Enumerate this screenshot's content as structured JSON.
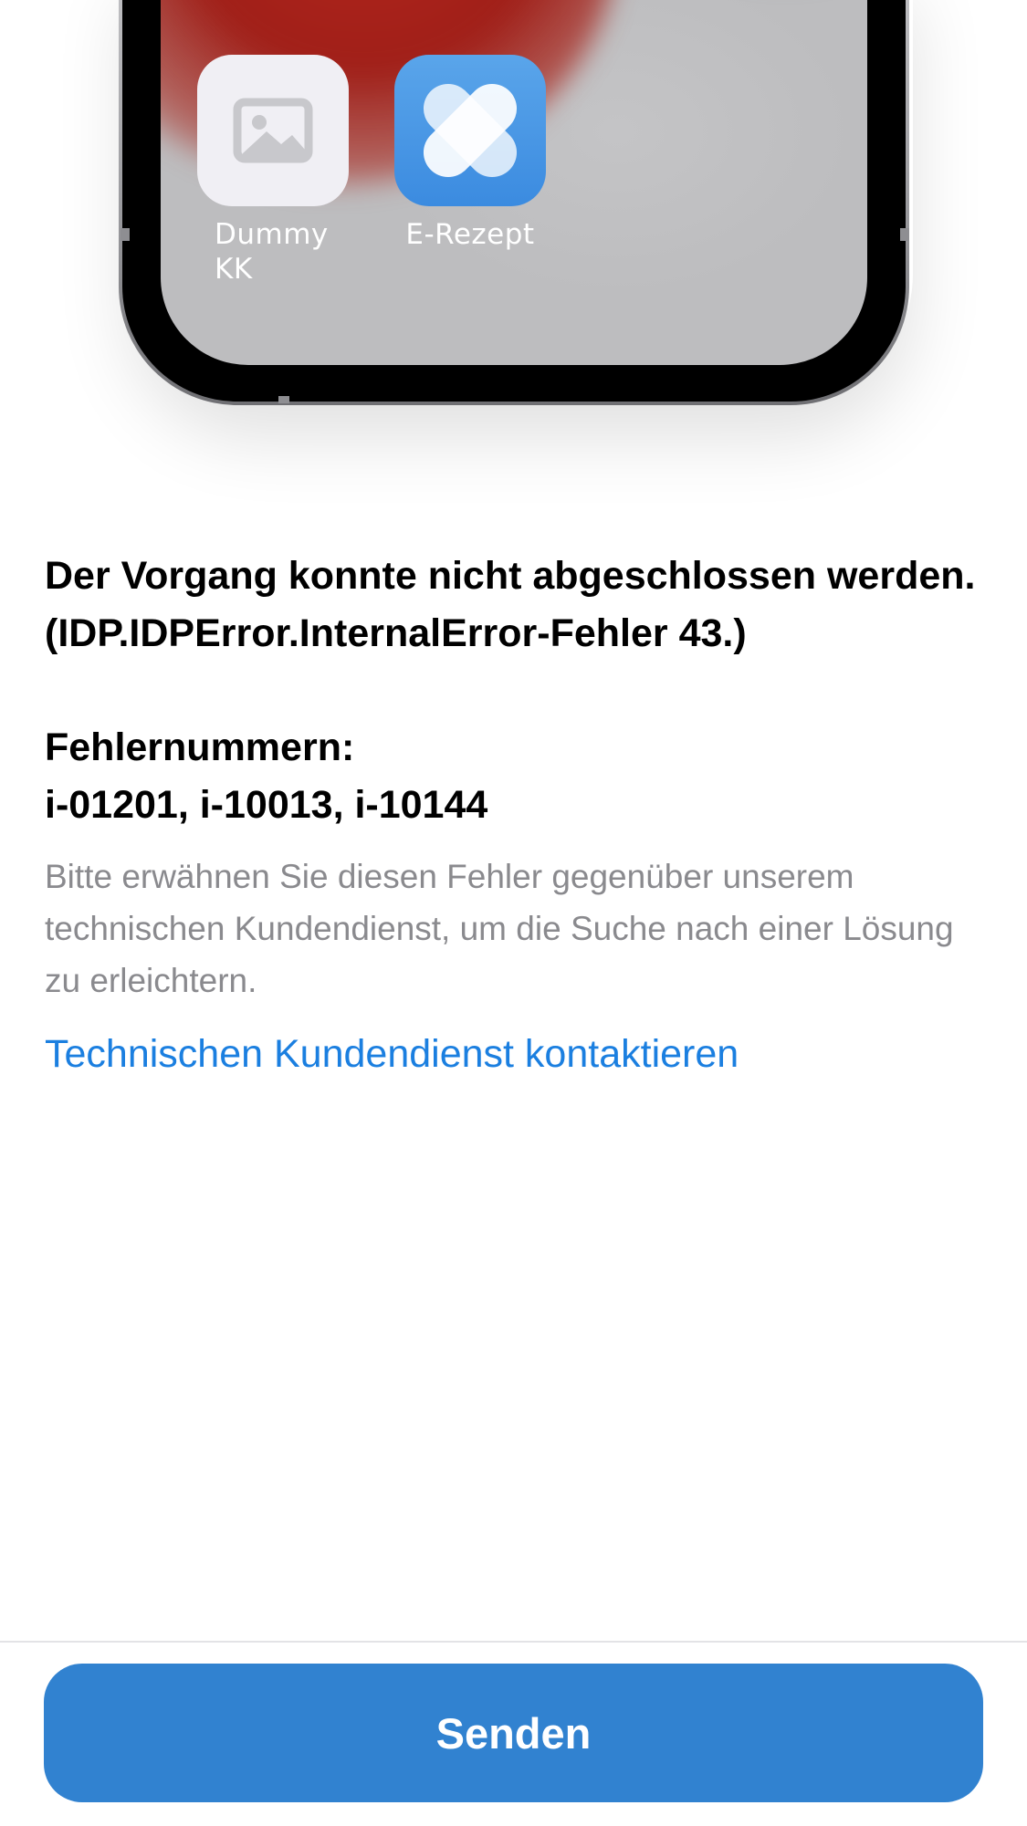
{
  "illustration": {
    "apps": [
      {
        "label": "Dummy KK",
        "label_line1": "Dummy",
        "label_line2": "KK",
        "icon": "image-placeholder-icon"
      },
      {
        "label": "E-Rezept",
        "icon": "heart-icon"
      }
    ]
  },
  "error": {
    "message": "Der Vorgang konnte nicht abgeschlossen werden. (IDP.IDPError.InternalError-Fehler 43.)",
    "codes_heading": "Fehlernummern:",
    "codes": "i-01201, i-10013, i-10144",
    "hint": "Bitte erwähnen Sie diesen Fehler gegenüber unserem technischen Kundendienst, um die Suche nach einer Lösung zu erleichtern.",
    "support_link": "Technischen Kundendienst kontaktieren"
  },
  "footer": {
    "send_label": "Senden"
  },
  "colors": {
    "accent": "#3182d0",
    "link": "#1b7fe0",
    "hint_text": "#8a8a8e"
  }
}
